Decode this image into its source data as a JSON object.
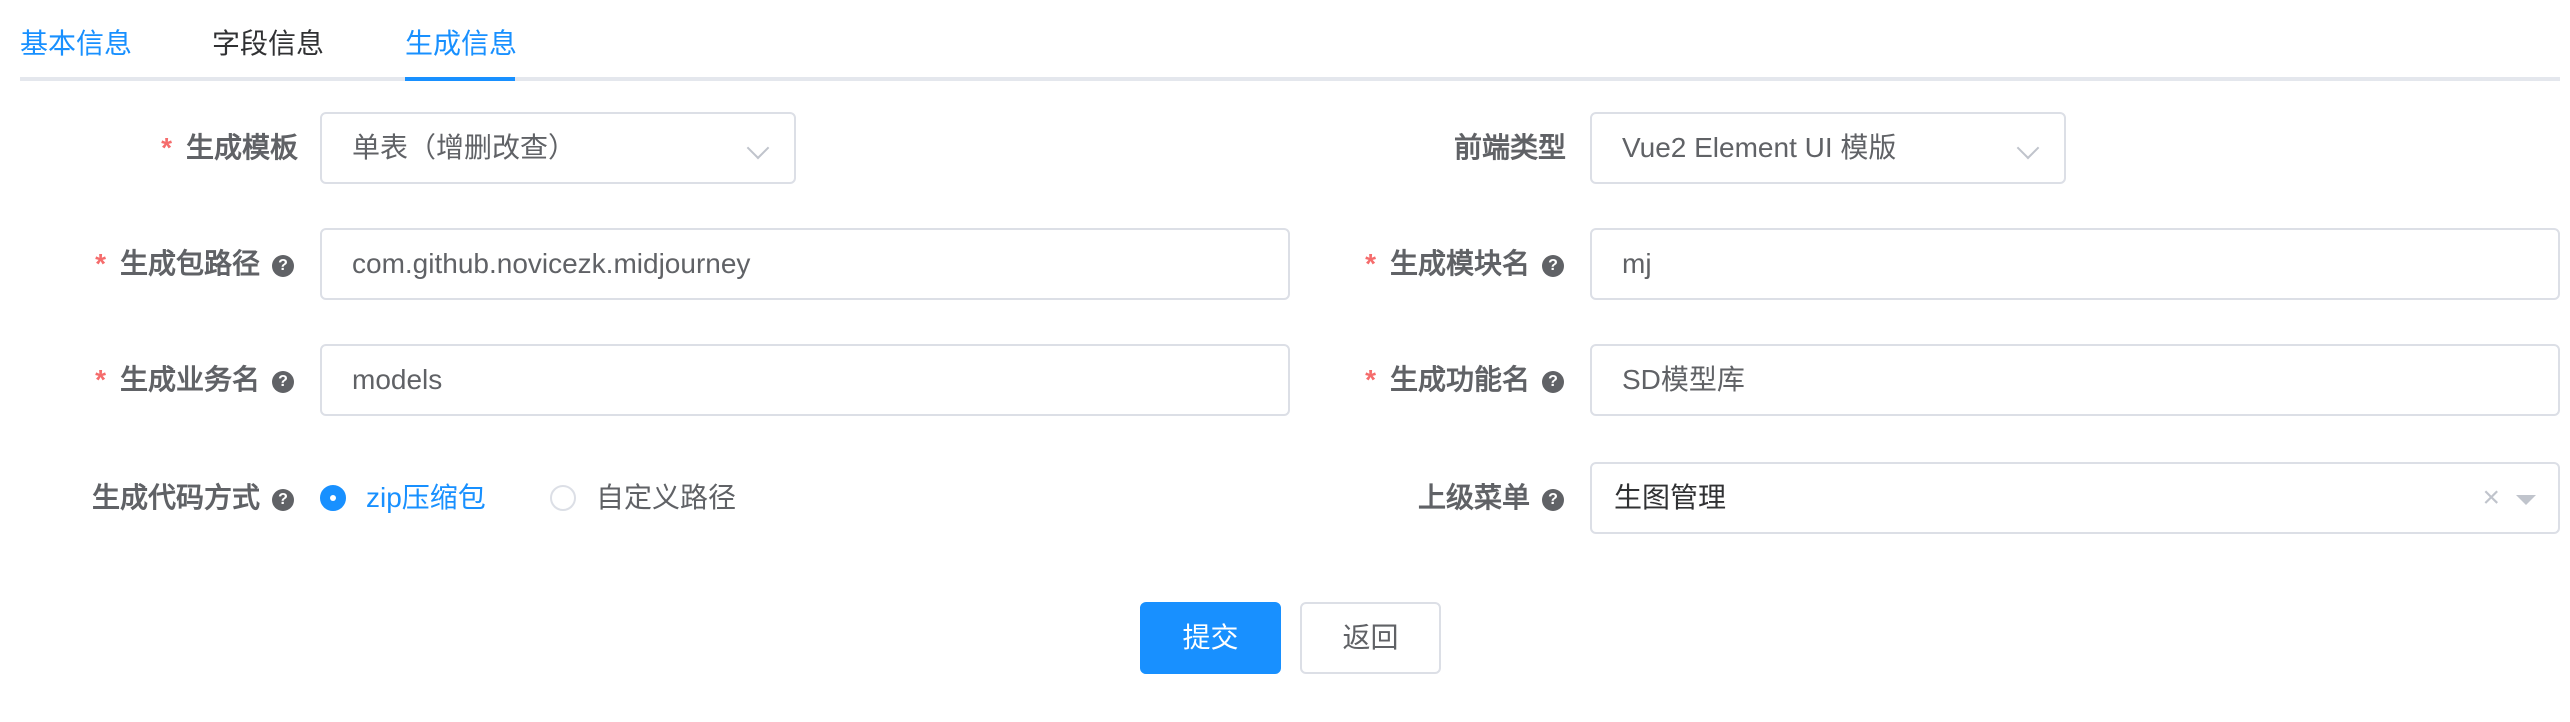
{
  "tabs": [
    "基本信息",
    "字段信息",
    "生成信息"
  ],
  "form": {
    "template": {
      "label": "生成模板",
      "value": "单表（增删改查）"
    },
    "frontend_type": {
      "label": "前端类型",
      "value": "Vue2 Element UI 模版"
    },
    "package_path": {
      "label": "生成包路径",
      "value": "com.github.novicezk.midjourney"
    },
    "module_name": {
      "label": "生成模块名",
      "value": "mj"
    },
    "business_name": {
      "label": "生成业务名",
      "value": "models"
    },
    "function_name": {
      "label": "生成功能名",
      "value": "SD模型库"
    },
    "gen_type": {
      "label": "生成代码方式",
      "options": [
        "zip压缩包",
        "自定义路径"
      ],
      "selected": "zip压缩包"
    },
    "parent_menu": {
      "label": "上级菜单",
      "value": "生图管理"
    }
  },
  "required_mark": "*",
  "help_glyph": "?",
  "clear_glyph": "×",
  "buttons": {
    "submit": "提交",
    "back": "返回"
  },
  "colors": {
    "primary": "#1890ff",
    "required": "#f56c6c",
    "border": "#dcdfe6",
    "text": "#606266"
  }
}
